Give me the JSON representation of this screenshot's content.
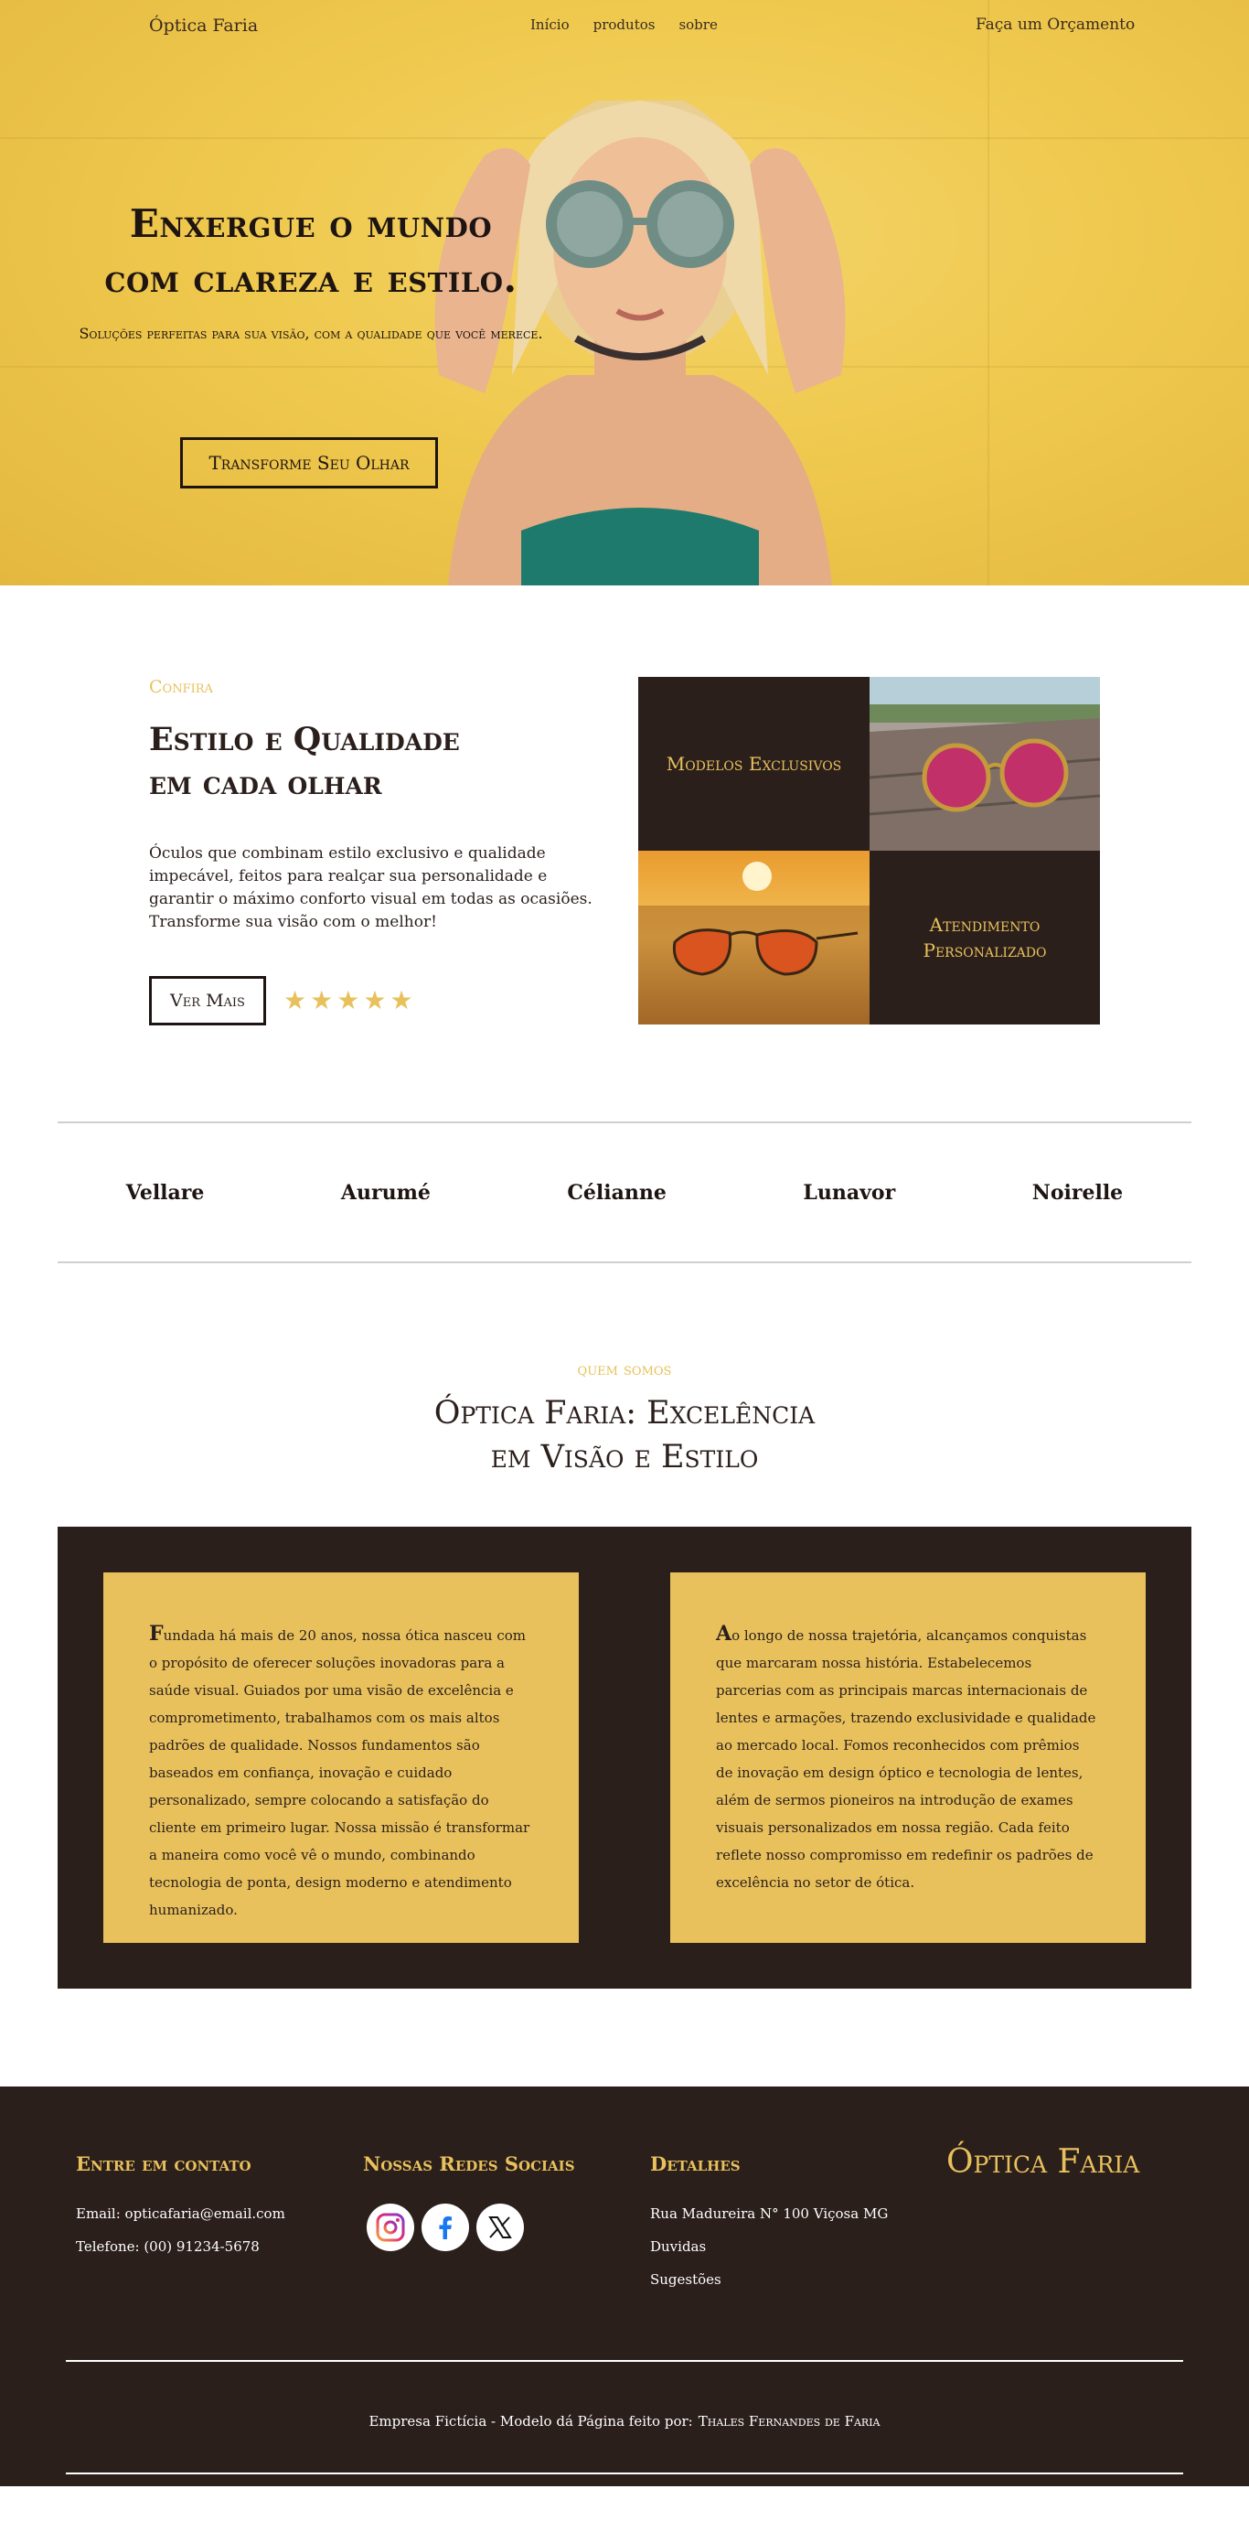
{
  "nav": {
    "brand": "Óptica Faria",
    "links": [
      "Início",
      "produtos",
      "sobre"
    ],
    "cta": "Faça um Orçamento"
  },
  "hero": {
    "title_line1": "Enxergue o mundo",
    "title_line2": "com clareza e estilo.",
    "subtitle": "Soluções perfeitas para sua visão, com a qualidade que você merece.",
    "button": "Transforme Seu Olhar"
  },
  "features": {
    "kicker": "Confira",
    "title_line1": "Estilo e Qualidade",
    "title_line2": "em cada olhar",
    "description": "Óculos que combinam estilo exclusivo e qualidade impecável, feitos para realçar sua personalidade e garantir o máximo conforto visual em todas as ocasiões. Transforme sua visão com o melhor!",
    "button": "Ver Mais",
    "rating": 5,
    "tile1": "Modelos Exclusivos",
    "tile2_line1": "Atendimento",
    "tile2_line2": "Personalizado"
  },
  "brands": [
    "Vellare",
    "Aurumé",
    "Célianne",
    "Lunavor",
    "Noirelle"
  ],
  "about": {
    "kicker": "quem somos",
    "title_line1": "Óptica Faria: Excelência",
    "title_line2": "em Visão e Estilo",
    "card1_cap": "F",
    "card1_text": "undada há mais de 20 anos, nossa ótica nasceu com o propósito de oferecer soluções inovadoras para a saúde visual. Guiados por uma visão de excelência e comprometimento, trabalhamos com os mais altos padrões de qualidade. Nossos fundamentos são baseados em confiança, inovação e cuidado personalizado, sempre colocando a satisfação do cliente em primeiro lugar. Nossa missão é transformar a maneira como você vê o mundo, combinando tecnologia de ponta, design moderno e atendimento humanizado.",
    "card2_cap": "A",
    "card2_text": "o longo de nossa trajetória, alcançamos conquistas que marcaram nossa história. Estabelecemos parcerias com as principais marcas internacionais de lentes e armações, trazendo exclusividade e qualidade ao mercado local. Fomos reconhecidos com prêmios de inovação em design óptico e tecnologia de lentes, além de sermos pioneiros na introdução de exames visuais personalizados em nossa região. Cada feito reflete nosso compromisso em redefinir os padrões de excelência no setor de ótica."
  },
  "footer": {
    "contact_title": "Entre em contato",
    "email": "Email: opticafaria@email.com",
    "phone": "Telefone: (00) 91234-5678",
    "social_title": "Nossas Redes Sociais",
    "social_icons": [
      "instagram-icon",
      "facebook-icon",
      "x-icon"
    ],
    "details_title": "Detalhes",
    "address": "Rua Madureira N° 100 Viçosa MG",
    "doubts": "Duvidas",
    "suggestions": "Sugestões",
    "brand": "Óptica Faria",
    "credit": "Empresa Fictícia - Modelo dá Página feito por:",
    "author": "Thales Fernandes de Faria"
  },
  "colors": {
    "accent": "#e8c15c",
    "dark": "#2b1f1c",
    "hero_bg": "#efc94e"
  }
}
